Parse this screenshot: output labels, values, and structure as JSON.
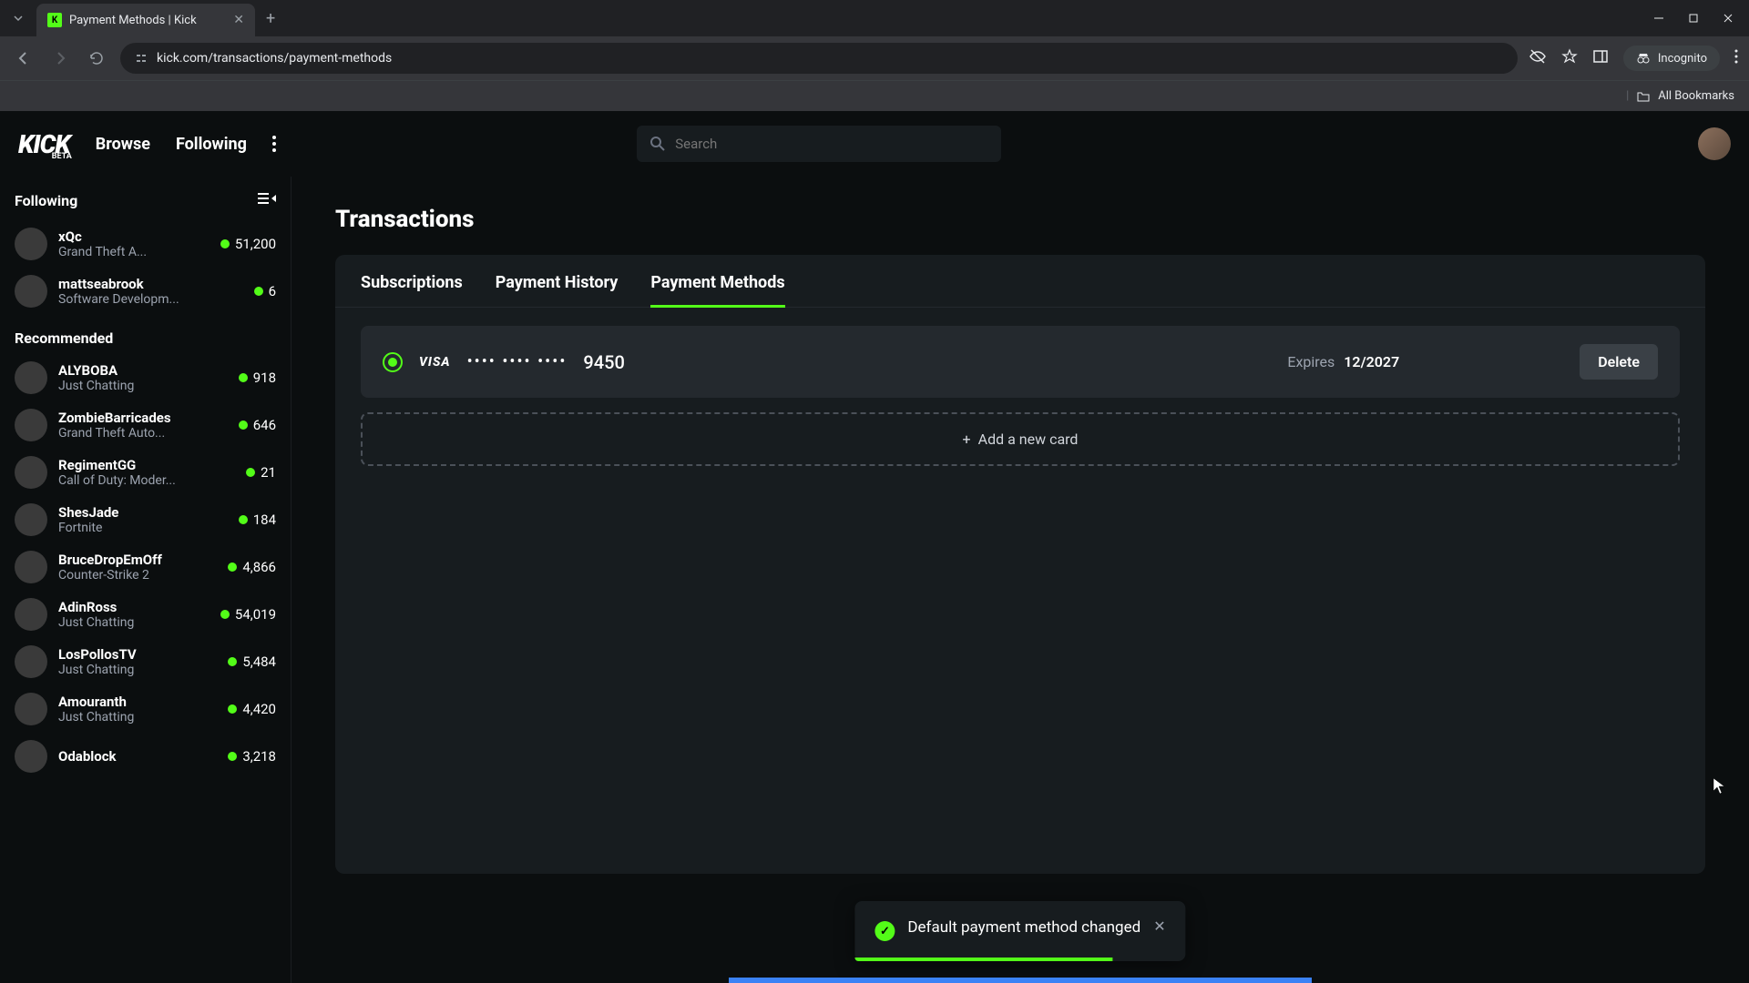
{
  "browser": {
    "tab_title": "Payment Methods | Kick",
    "url": "kick.com/transactions/payment-methods",
    "incognito_label": "Incognito",
    "all_bookmarks": "All Bookmarks"
  },
  "header": {
    "logo": "KICK",
    "logo_beta": "BETA",
    "nav_browse": "Browse",
    "nav_following": "Following",
    "search_placeholder": "Search"
  },
  "sidebar": {
    "following_title": "Following",
    "recommended_title": "Recommended",
    "following": [
      {
        "name": "xQc",
        "game": "Grand Theft A...",
        "viewers": "51,200"
      },
      {
        "name": "mattseabrook",
        "game": "Software Developm...",
        "viewers": "6"
      }
    ],
    "recommended": [
      {
        "name": "ALYBOBA",
        "game": "Just Chatting",
        "viewers": "918"
      },
      {
        "name": "ZombieBarricades",
        "game": "Grand Theft Auto...",
        "viewers": "646"
      },
      {
        "name": "RegimentGG",
        "game": "Call of Duty: Moder...",
        "viewers": "21"
      },
      {
        "name": "ShesJade",
        "game": "Fortnite",
        "viewers": "184"
      },
      {
        "name": "BruceDropEmOff",
        "game": "Counter-Strike 2",
        "viewers": "4,866"
      },
      {
        "name": "AdinRoss",
        "game": "Just Chatting",
        "viewers": "54,019"
      },
      {
        "name": "LosPollosTV",
        "game": "Just Chatting",
        "viewers": "5,484"
      },
      {
        "name": "Amouranth",
        "game": "Just Chatting",
        "viewers": "4,420"
      },
      {
        "name": "Odablock",
        "game": "",
        "viewers": "3,218"
      }
    ]
  },
  "main": {
    "page_title": "Transactions",
    "tabs": {
      "subscriptions": "Subscriptions",
      "payment_history": "Payment History",
      "payment_methods": "Payment Methods"
    },
    "card": {
      "brand": "VISA",
      "masked": "•••• •••• ••••",
      "last4": "9450",
      "expires_label": "Expires",
      "expires_date": "12/2027",
      "delete_label": "Delete"
    },
    "add_card_label": "Add a new card"
  },
  "toast": {
    "message": "Default payment method changed"
  }
}
